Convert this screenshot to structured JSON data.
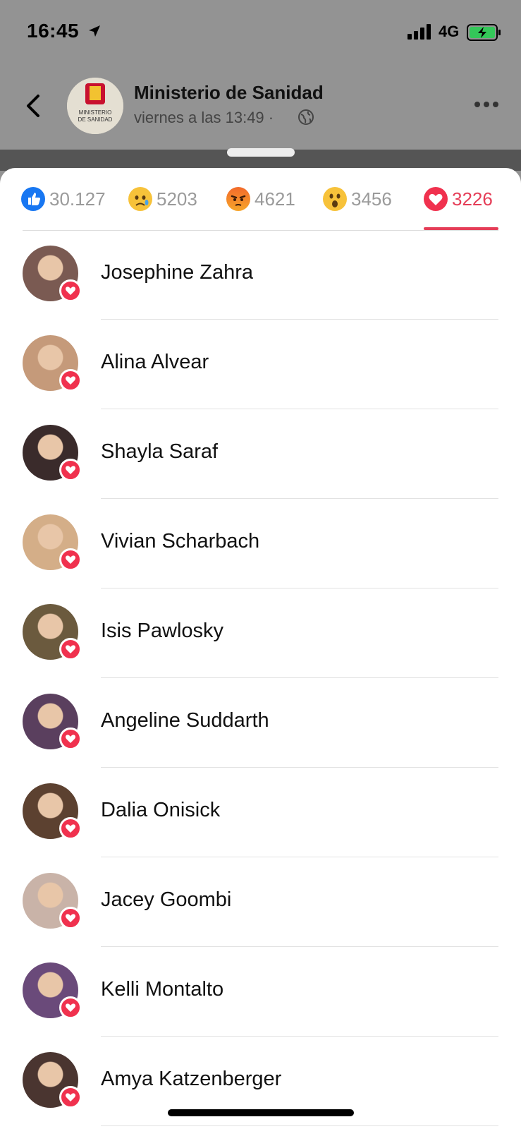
{
  "status_bar": {
    "time": "16:45",
    "network": "4G",
    "location_icon": "location-arrow-icon",
    "signal_icon": "cellular-signal-icon",
    "battery_icon": "battery-charging-icon"
  },
  "post_header": {
    "page_name": "Ministerio de Sanidad",
    "post_time": "viernes a las 13:49 ·",
    "avatar_line1": "MINISTERIO",
    "avatar_line2": "DE SANIDAD"
  },
  "reaction_tabs": [
    {
      "name": "like",
      "count": "30.127",
      "icon": "like-icon"
    },
    {
      "name": "sad",
      "count": "5203",
      "icon": "sad-icon"
    },
    {
      "name": "angry",
      "count": "4621",
      "icon": "angry-icon"
    },
    {
      "name": "wow",
      "count": "3456",
      "icon": "wow-icon"
    },
    {
      "name": "love",
      "count": "3226",
      "icon": "heart-icon",
      "active": true
    }
  ],
  "users": [
    {
      "name": "Josephine Zahra",
      "avatar_color": "#7a5a52"
    },
    {
      "name": "Alina Alvear",
      "avatar_color": "#c59a7a"
    },
    {
      "name": "Shayla Saraf",
      "avatar_color": "#3a2b2b"
    },
    {
      "name": "Vivian Scharbach",
      "avatar_color": "#d4ae88"
    },
    {
      "name": "Isis Pawlosky",
      "avatar_color": "#6b5a3e"
    },
    {
      "name": "Angeline Suddarth",
      "avatar_color": "#5a3f5e"
    },
    {
      "name": "Dalia Onisick",
      "avatar_color": "#5c4130"
    },
    {
      "name": "Jacey Goombi",
      "avatar_color": "#c9b3a8"
    },
    {
      "name": "Kelli Montalto",
      "avatar_color": "#6a4a7a"
    },
    {
      "name": "Amya Katzenberger",
      "avatar_color": "#4a3530"
    }
  ],
  "colors": {
    "accent": "#e53d57",
    "inactive_count": "#9a9a9a",
    "like_blue": "#1877f2",
    "love_red": "#f0314e"
  }
}
